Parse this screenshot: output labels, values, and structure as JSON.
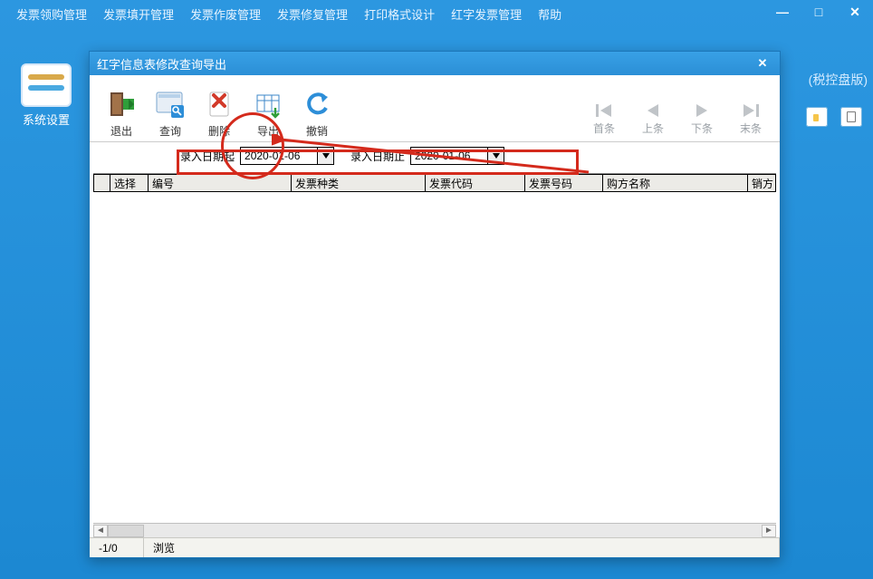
{
  "outer_window": {
    "minimize": "—",
    "maximize": "□",
    "close": "✕"
  },
  "menu": {
    "items": [
      "发票领购管理",
      "发票填开管理",
      "发票作废管理",
      "发票修复管理",
      "打印格式设计",
      "红字发票管理",
      "帮助"
    ]
  },
  "rail": {
    "label": "系统设置"
  },
  "right_badge": "(税控盘版)",
  "dialog": {
    "title": "红字信息表修改查询导出",
    "close": "✕",
    "toolbar": {
      "exit": "退出",
      "query": "查询",
      "delete": "删除",
      "export": "导出",
      "undo": "撤销"
    },
    "nav": {
      "first": "首条",
      "prev": "上条",
      "next": "下条",
      "last": "末条"
    },
    "filter": {
      "from_label": "录入日期起",
      "from_value": "2020-01-06",
      "to_label": "录入日期止",
      "to_value": "2020-01-06"
    },
    "grid": {
      "headers": [
        "",
        "选择",
        "编号",
        "发票种类",
        "发票代码",
        "发票号码",
        "购方名称",
        "销方"
      ],
      "row_marker": "▶"
    },
    "status": {
      "counter": "-1/0",
      "mode": "浏览"
    }
  }
}
